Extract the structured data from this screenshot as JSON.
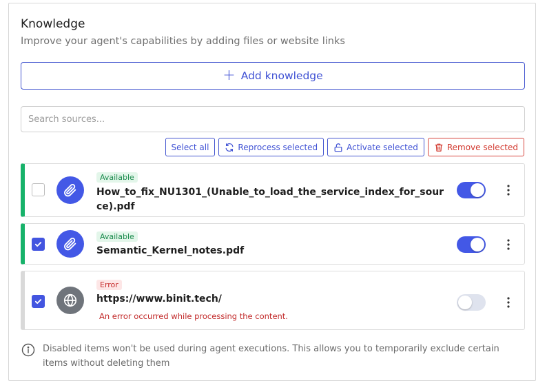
{
  "section": {
    "title": "Knowledge",
    "subtitle": "Improve your agent's capabilities by adding files or website links",
    "add_button": "Add knowledge"
  },
  "search": {
    "placeholder": "Search sources..."
  },
  "bulk_actions": {
    "select_all": "Select all",
    "reprocess": "Reprocess selected",
    "activate": "Activate selected",
    "remove": "Remove selected"
  },
  "items": [
    {
      "status": "Available",
      "name": "How_to_fix_NU1301_(Unable_to_load_the_service_index_for_source).pdf",
      "type_icon": "paperclip-icon",
      "checked": false,
      "enabled": true
    },
    {
      "status": "Available",
      "name": "Semantic_Kernel_notes.pdf",
      "type_icon": "paperclip-icon",
      "checked": true,
      "enabled": true
    },
    {
      "status": "Error",
      "name": "https://www.binit.tech/",
      "type_icon": "globe-icon",
      "checked": true,
      "enabled": false,
      "error": "An error occurred while processing the content."
    }
  ],
  "footer_note": "Disabled items won't be used during agent executions. This allows you to temporarily exclude certain items without deleting them",
  "colors": {
    "accent": "#4358e6",
    "available": "#17b26a",
    "error": "#c22a2a"
  }
}
